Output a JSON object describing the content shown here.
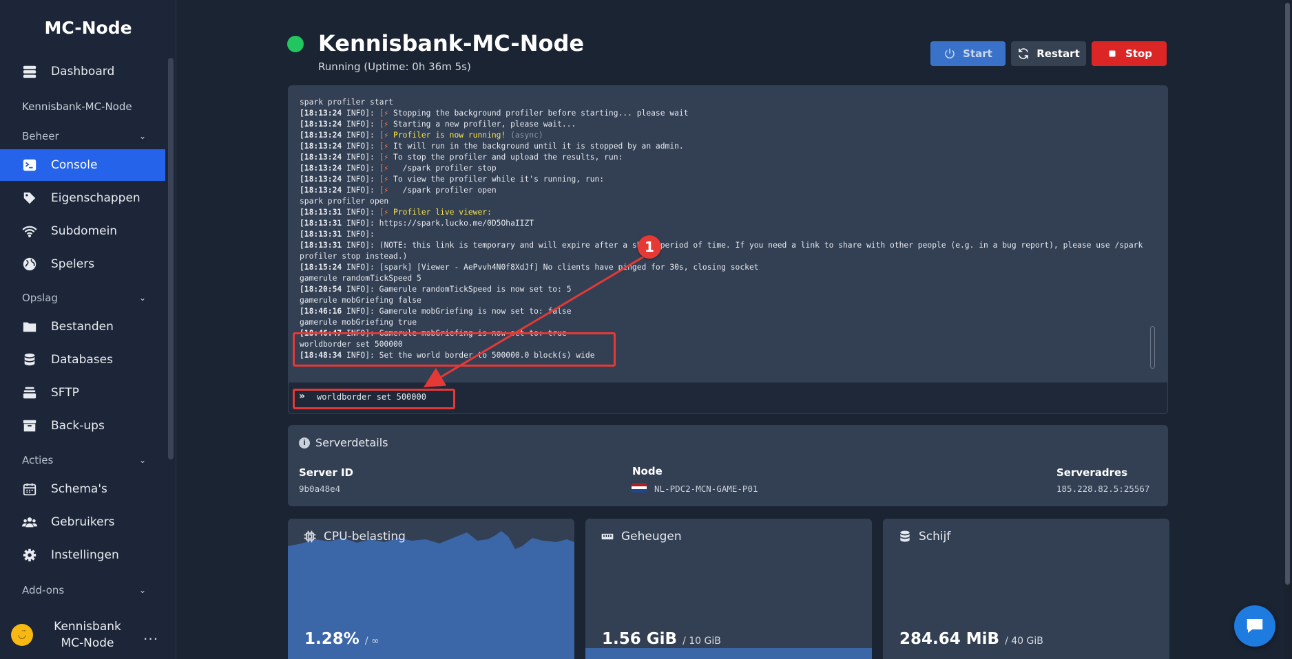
{
  "sidebar": {
    "brand": "MC-Node",
    "server_name": "Kennisbank-MC-Node",
    "dashboard": "Dashboard",
    "sections": {
      "beheer": "Beheer",
      "opslag": "Opslag",
      "acties": "Acties",
      "addons": "Add-ons"
    },
    "items": {
      "console": "Console",
      "eigenschappen": "Eigenschappen",
      "subdomein": "Subdomein",
      "spelers": "Spelers",
      "bestanden": "Bestanden",
      "databases": "Databases",
      "sftp": "SFTP",
      "backups": "Back-ups",
      "schemas": "Schema's",
      "gebruikers": "Gebruikers",
      "instellingen": "Instellingen"
    },
    "user": {
      "name": "Kennisbank MC-Node",
      "menu": "..."
    }
  },
  "header": {
    "title": "Kennisbank-MC-Node",
    "status": "Running (Uptime: 0h 36m 5s)",
    "status_color": "#22c55e",
    "start_label": "Start",
    "restart_label": "Restart",
    "stop_label": "Stop"
  },
  "console": {
    "lines": [
      {
        "text": "spark profiler start"
      },
      {
        "ts": "[18:13:24",
        "rest": " INFO]: ",
        "bolt": "[⚡ ",
        "msg": "Stopping the background profiler before starting... please wait"
      },
      {
        "ts": "[18:13:24",
        "rest": " INFO]: ",
        "bolt": "[⚡ ",
        "msg": "Starting a new profiler, please wait..."
      },
      {
        "ts": "[18:13:24",
        "rest": " INFO]: ",
        "bolt": "[⚡ ",
        "yel": "Profiler is now running!",
        "grey": " (async)"
      },
      {
        "ts": "[18:13:24",
        "rest": " INFO]: ",
        "bolt": "[⚡ ",
        "msg": "It will run in the background until it is stopped by an admin."
      },
      {
        "ts": "[18:13:24",
        "rest": " INFO]: ",
        "bolt": "[⚡ ",
        "msg": "To stop the profiler and upload the results, run:"
      },
      {
        "ts": "[18:13:24",
        "rest": " INFO]: ",
        "bolt": "[⚡ ",
        "msg": "  /spark profiler stop"
      },
      {
        "ts": "[18:13:24",
        "rest": " INFO]: ",
        "bolt": "[⚡ ",
        "msg": "To view the profiler while it's running, run:"
      },
      {
        "ts": "[18:13:24",
        "rest": " INFO]: ",
        "bolt": "[⚡ ",
        "msg": "  /spark profiler open"
      },
      {
        "text": "spark profiler open"
      },
      {
        "ts": "[18:13:31",
        "rest": " INFO]: ",
        "bolt": "[⚡ ",
        "yel": "Profiler live viewer:"
      },
      {
        "ts": "[18:13:31",
        "rest": " INFO]: ",
        "msg": "https://spark.lucko.me/0D5OhaIIZT"
      },
      {
        "ts": "[18:13:31",
        "rest": " INFO]: ",
        "msg": ""
      },
      {
        "ts": "[18:13:31",
        "rest": " INFO]: ",
        "msg": "(NOTE: this link is temporary and will expire after a short period of time. If you need a link to share with other people (e.g. in a bug report), please use /spark profiler stop instead.)"
      },
      {
        "ts": "[18:15:24",
        "rest": " INFO]: ",
        "msg": "[spark] [Viewer - AePvvh4N0f8XdJf] No clients have pinged for 30s, closing socket"
      },
      {
        "text": "gamerule randomTickSpeed 5"
      },
      {
        "ts": "[18:20:54",
        "rest": " INFO]: ",
        "msg": "Gamerule randomTickSpeed is now set to: 5"
      },
      {
        "text": "gamerule mobGriefing false"
      },
      {
        "ts": "[18:46:16",
        "rest": " INFO]: ",
        "msg": "Gamerule mobGriefing is now set to: false"
      },
      {
        "text": "gamerule mobGriefing true"
      },
      {
        "ts": "[18:46:47",
        "rest": " INFO]: ",
        "msg": "Gamerule mobGriefing is now set to: true"
      },
      {
        "text": "worldborder set 500000"
      },
      {
        "ts": "[18:48:34",
        "rest": " INFO]: ",
        "msg": "Set the world border to 500000.0 block(s) wide"
      }
    ],
    "command_input": "worldborder set 500000",
    "annotation_number": "1"
  },
  "details": {
    "title": "Serverdetails",
    "server_id_label": "Server ID",
    "server_id": "9b0a48e4",
    "node_label": "Node",
    "node": "NL-PDC2-MCN-GAME-P01",
    "address_label": "Serveradres",
    "address": "185.228.82.5:25567"
  },
  "stats": {
    "cpu": {
      "title": "CPU-belasting",
      "value": "1.28%",
      "limit": "/ ∞"
    },
    "memory": {
      "title": "Geheugen",
      "value": "1.56 GiB",
      "limit": "/ 10 GiB",
      "fill_percent": 15.6
    },
    "disk": {
      "title": "Schijf",
      "value": "284.64 MiB",
      "limit": "/ 40 GiB"
    }
  },
  "colors": {
    "accent": "#2563eb",
    "danger": "#dc2626",
    "annotation": "#e53935",
    "chart_fill": "#3b66a8"
  }
}
